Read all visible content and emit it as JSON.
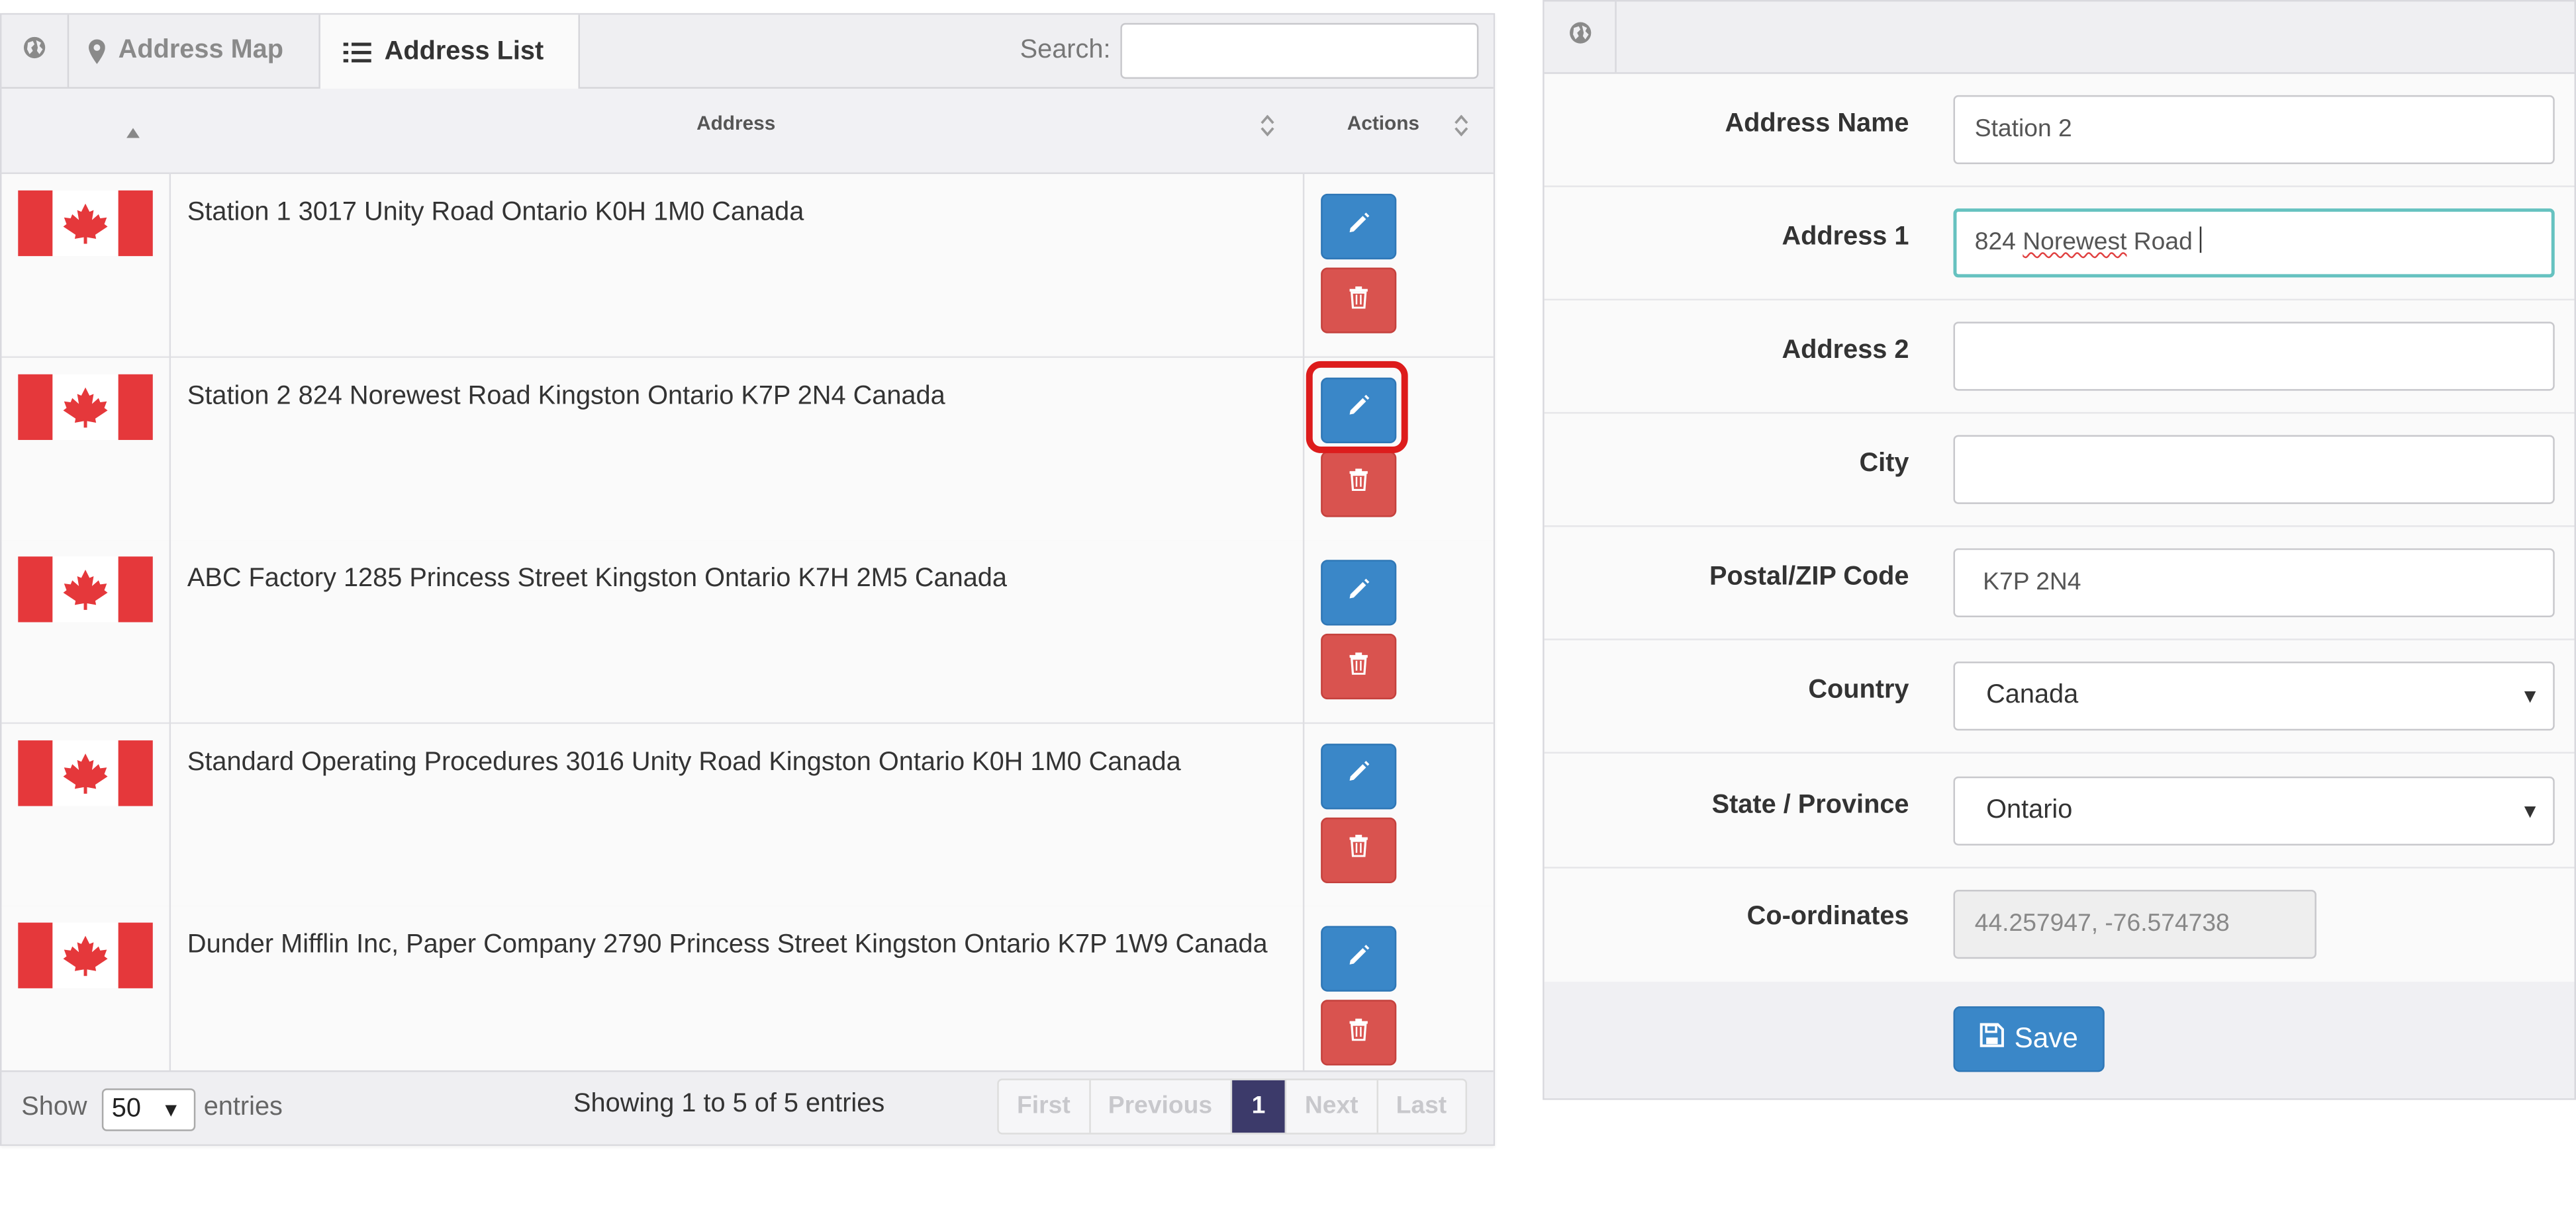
{
  "tabs": {
    "globe_icon": "globe-icon",
    "map_label": "Address Map",
    "list_label": "Address List",
    "active": "Address List"
  },
  "search": {
    "label": "Search:",
    "value": ""
  },
  "table": {
    "columns": [
      "",
      "Address",
      "Actions"
    ],
    "rows": [
      {
        "flag": "Canada",
        "address": "Station 1 3017 Unity Road Ontario K0H 1M0 Canada"
      },
      {
        "flag": "Canada",
        "address": "Station 2 824 Norewest Road Kingston Ontario K7P 2N4 Canada"
      },
      {
        "flag": "Canada",
        "address": "ABC Factory 1285 Princess Street Kingston Ontario K7H 2M5 Canada"
      },
      {
        "flag": "Canada",
        "address": "Standard Operating Procedures 3016 Unity Road Kingston Ontario K0H 1M0 Canada"
      },
      {
        "flag": "Canada",
        "address": "Dunder Mifflin Inc, Paper Company 2790 Princess Street Kingston Ontario K7P 1W9 Canada"
      }
    ],
    "highlighted_row": 2
  },
  "footer": {
    "show_label": "Show",
    "page_length": "50",
    "entries_label": "entries",
    "info": "Showing 1 to 5 of 5 entries",
    "pager": {
      "first": "First",
      "previous": "Previous",
      "current": "1",
      "next": "Next",
      "last": "Last"
    }
  },
  "form": {
    "fields": [
      {
        "label": "Address Name",
        "value": "Station 2"
      },
      {
        "label": "Address 1",
        "value_part1": "824 ",
        "value_misspelled": "Norewest",
        "value_part2": " Road"
      },
      {
        "label": "Address 2",
        "value": ""
      },
      {
        "label": "City",
        "value": ""
      },
      {
        "label": "Postal/ZIP Code",
        "value": "K7P 2N4"
      },
      {
        "label": "Country",
        "value": "Canada"
      },
      {
        "label": "State / Province",
        "value": "Ontario"
      },
      {
        "label": "Co-ordinates",
        "value": "44.257947, -76.574738"
      }
    ],
    "save_label": "Save"
  },
  "colors": {
    "primary": "#3a87c8",
    "danger": "#d9534f",
    "highlight": "#dd1c1c",
    "pager_active": "#3c3a6a",
    "flag_red": "#e5383b"
  }
}
